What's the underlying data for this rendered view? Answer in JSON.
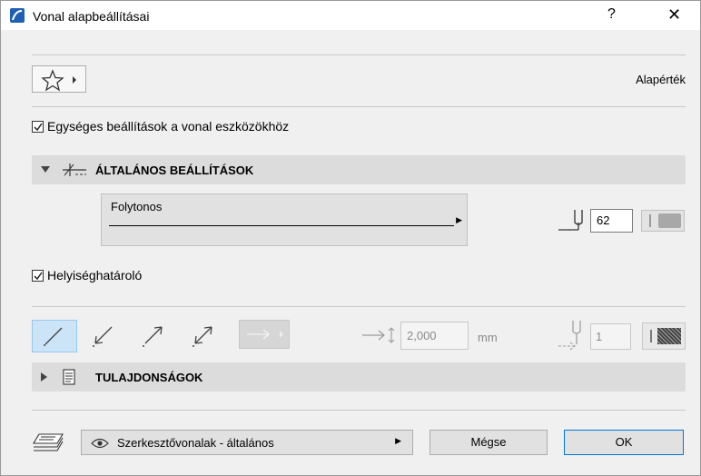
{
  "window": {
    "title": "Vonal alapbeállításai",
    "help": "?",
    "close": "✕"
  },
  "favorites": {
    "icon": "star-icon"
  },
  "default_label": "Alapérték",
  "uniform_settings": {
    "label": "Egységes beállítások a vonal eszközökhöz",
    "checked": true
  },
  "general_panel": {
    "label": "ÁLTALÁNOS BEÁLLÍTÁSOK",
    "expanded": true
  },
  "line_type": {
    "label": "Folytonos"
  },
  "pen": {
    "value": "62"
  },
  "zone_boundary": {
    "label": "Helyiséghatároló",
    "checked": true
  },
  "arrowheads": {
    "size_value": "2,000",
    "unit": "mm",
    "pen_value": "1"
  },
  "properties_panel": {
    "label": "TULAJDONSÁGOK",
    "expanded": false
  },
  "layer": {
    "label": "Szerkesztővonalak - általános"
  },
  "buttons": {
    "cancel": "Mégse",
    "ok": "OK"
  },
  "colors": {
    "accent": "#0078d7",
    "selected_bg": "#cce4f7"
  }
}
